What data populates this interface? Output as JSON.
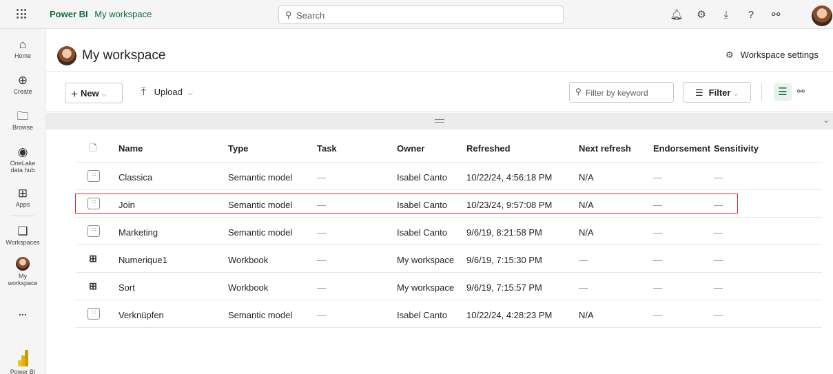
{
  "topbar": {
    "app_name": "Power BI",
    "workspace_link": "My workspace",
    "search_placeholder": "Search",
    "icons": [
      "bell-icon",
      "gear-icon",
      "download-icon",
      "help-icon",
      "share-icon"
    ]
  },
  "leftnav": {
    "items": [
      {
        "label": "Home",
        "icon": "home-icon"
      },
      {
        "label": "Create",
        "icon": "plus-circle-icon"
      },
      {
        "label": "Browse",
        "icon": "folder-icon"
      },
      {
        "label_line1": "OneLake",
        "label_line2": "data hub",
        "icon": "onelake-icon"
      },
      {
        "label": "Apps",
        "icon": "apps-icon"
      },
      {
        "label": "Workspaces",
        "icon": "workspaces-icon"
      },
      {
        "label_line1": "My",
        "label_line2": "workspace",
        "icon": "avatar"
      },
      {
        "label": "...",
        "icon": "more-icon"
      },
      {
        "label": "Power BI",
        "icon": "power-bi-logo"
      }
    ]
  },
  "header": {
    "title": "My workspace",
    "settings_label": "Workspace settings"
  },
  "toolbar": {
    "new_label": "New",
    "upload_label": "Upload",
    "filter_placeholder": "Filter by keyword",
    "filter_label": "Filter"
  },
  "table": {
    "columns": [
      "Name",
      "Type",
      "Task",
      "Owner",
      "Refreshed",
      "Next refresh",
      "Endorsement",
      "Sensitivity"
    ],
    "rows": [
      {
        "icon": "semantic-model",
        "name": "Classica",
        "type": "Semantic model",
        "task": "—",
        "owner": "Isabel Canto",
        "refreshed": "10/22/24, 4:56:18 PM",
        "next_refresh": "N/A",
        "endorsement": "—",
        "sensitivity": "—"
      },
      {
        "icon": "semantic-model",
        "name": "Join",
        "type": "Semantic model",
        "task": "—",
        "owner": "Isabel Canto",
        "refreshed": "10/23/24, 9:57:08 PM",
        "next_refresh": "N/A",
        "endorsement": "—",
        "sensitivity": "—"
      },
      {
        "icon": "semantic-model",
        "name": "Marketing",
        "type": "Semantic model",
        "task": "—",
        "owner": "Isabel Canto",
        "refreshed": "9/6/19, 8:21:58 PM",
        "next_refresh": "N/A",
        "endorsement": "—",
        "sensitivity": "—"
      },
      {
        "icon": "workbook",
        "name": "Numerique1",
        "type": "Workbook",
        "task": "—",
        "owner": "My workspace",
        "refreshed": "9/6/19, 7:15:30 PM",
        "next_refresh": "—",
        "endorsement": "—",
        "sensitivity": "—"
      },
      {
        "icon": "workbook",
        "name": "Sort",
        "type": "Workbook",
        "task": "—",
        "owner": "My workspace",
        "refreshed": "9/6/19, 7:15:57 PM",
        "next_refresh": "—",
        "endorsement": "—",
        "sensitivity": "—"
      },
      {
        "icon": "semantic-model",
        "name": "Verknüpfen",
        "type": "Semantic model",
        "task": "—",
        "owner": "Isabel Canto",
        "refreshed": "10/22/24, 4:28:23 PM",
        "next_refresh": "N/A",
        "endorsement": "—",
        "sensitivity": "—"
      }
    ]
  },
  "colors": {
    "brand_green": "#0f6b3e",
    "highlight_red": "#e0282e"
  }
}
